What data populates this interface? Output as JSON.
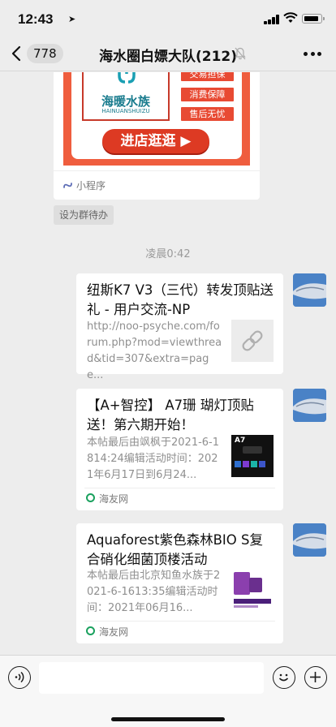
{
  "status_bar": {
    "time": "12:43"
  },
  "nav": {
    "unread_count": "778",
    "title": "海水圈白嫖大队(212)"
  },
  "mini_program": {
    "brand_name_cn": "海暖水族",
    "brand_name_en": "HAINUANSHUIZU",
    "tags": [
      "交易担保",
      "消费保障",
      "售后无忧"
    ],
    "button_label": "进店逛逛",
    "footer_label": "小程序"
  },
  "set_pending_label": "设为群待办",
  "timestamp": "凌晨0:42",
  "messages": [
    {
      "title": "纽斯K7 V3（三代）转发顶贴送礼 - 用户交流-NP",
      "description": "http://noo-psyche.com/forum.php?mod=viewthread&tid=307&extra=page...",
      "thumb_icon": "link-icon"
    },
    {
      "title": "【A+智控】 A7珊 瑚灯顶贴送！第六期开始！",
      "description": "本帖最后由飒枫于2021-6-1814:24编辑活动时间：2021年6月17日到6月24...",
      "thumb_label": "A7",
      "source": "海友网"
    },
    {
      "title": "Aquaforest紫色森林BIO S复合硝化细菌顶楼活动",
      "description": "本帖最后由北京知鱼水族于2021-6-1613:35编辑活动时间：2021年06月16...",
      "source": "海友网"
    }
  ],
  "colors": {
    "accent_green": "#1aa15e",
    "poster_red": "#ef5d3e",
    "avatar_blue": "#4a82c6"
  }
}
